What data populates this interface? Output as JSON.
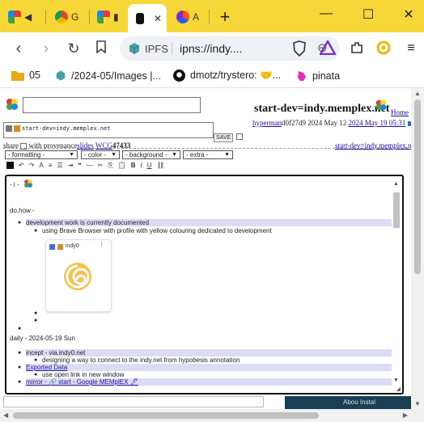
{
  "browser": {
    "tabs": [
      {
        "label": "",
        "icon": "flower-logo-icon"
      },
      {
        "label": "",
        "icon": "chrome-icon"
      },
      {
        "label": "",
        "icon": "flower-logo-icon"
      },
      {
        "label": "",
        "icon": "notebook-icon"
      },
      {
        "label": "A",
        "icon": "brave-logo-icon"
      }
    ],
    "url": "ipns://indy....",
    "ipfs_label": "IPFS",
    "bookmarks": [
      {
        "label": "05",
        "icon": "folder-icon"
      },
      {
        "label": "/2024-05/Images |...",
        "icon": "ipfs-cube-icon"
      },
      {
        "label": "dmotz/trystero: 🤝...",
        "icon": "github-icon"
      },
      {
        "label": "pinata",
        "icon": "pinata-icon"
      }
    ]
  },
  "page": {
    "site_title": "start-dev=indy.memplex.net",
    "home_link": "Home",
    "meta_user": "hyperman",
    "meta_hash": "d0f27d9",
    "meta_date": "2024 May 12",
    "meta_date2": "2024 May 19 05:31",
    "path_value": "start-dev=indy.memplex.net",
    "save_label": "SAVE",
    "share_label": "share",
    "provenance_label": "with provenance",
    "slides_link": "slides",
    "wcg_link": "WCG",
    "wcg_count": "47433",
    "right_link": "start-dev=indy.memplex.net",
    "dropdowns": [
      "- formatting -",
      "- color -",
      "- background -",
      "- extra -"
    ],
    "editor": {
      "i_label": "- i -",
      "section1": "do.how -",
      "item1": "development work is currently documented",
      "sub1": "using Brave Browser with profile with yellow colouring  dedicated to development",
      "embed_label": "indy0",
      "section2": "daily - 2024-05-19 Sun",
      "item2": "incept - via.indy0.net",
      "sub2": "designing a way to connect to the indy.net from hypobesis annotation",
      "item3": "Exported Data",
      "sub3": "use open link in new window",
      "item4": "mirror - 🔗 start - Google MEMplEX 🖊"
    },
    "footer_text": "Abou   Instal"
  },
  "colors": {
    "tabstrip": "#f7d737",
    "highlight": "#dcdcf7",
    "link": "#1a0dab"
  }
}
